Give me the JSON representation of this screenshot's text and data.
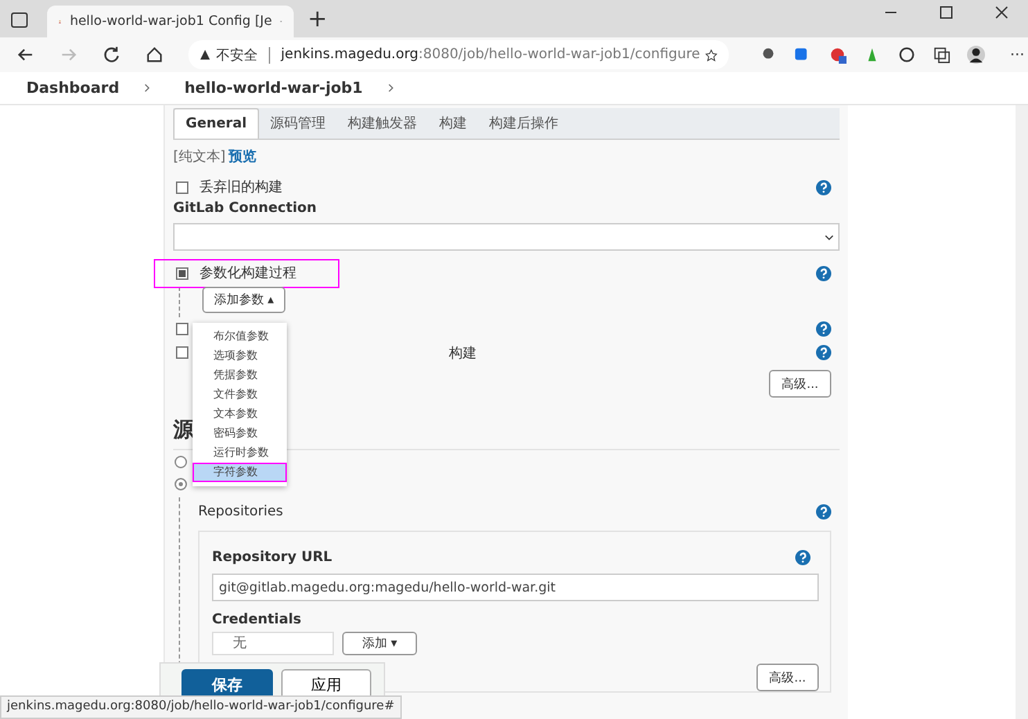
{
  "browser": {
    "tab_title": "hello-world-war-job1 Config [Je",
    "new_tab": "+",
    "security": "不安全",
    "url_host": "jenkins.magedu.org",
    "url_rest": ":8080/job/hello-world-war-job1/configure",
    "more": "···"
  },
  "breadcrumbs": [
    {
      "label": "Dashboard"
    },
    {
      "label": "hello-world-war-job1"
    }
  ],
  "tabs": [
    {
      "label": "General",
      "selected": true
    },
    {
      "label": "源码管理",
      "selected": false
    },
    {
      "label": "构建触发器",
      "selected": false
    },
    {
      "label": "构建",
      "selected": false
    },
    {
      "label": "构建后操作",
      "selected": false
    }
  ],
  "description_links": {
    "plain": "[纯文本]",
    "preview": "预览"
  },
  "options_top": [
    {
      "label": "丢弃旧的构建",
      "checked": false
    }
  ],
  "gitlab_connection": {
    "label": "GitLab Connection"
  },
  "param_option": {
    "label": "参数化构建过程",
    "checked": true,
    "highlighted": true
  },
  "add_param_button": "添加参数 ▴",
  "param_menu": [
    {
      "label": "布尔值参数",
      "selected": false,
      "highlighted": false
    },
    {
      "label": "选项参数",
      "selected": false,
      "highlighted": false
    },
    {
      "label": "凭据参数",
      "selected": false,
      "highlighted": false
    },
    {
      "label": "文件参数",
      "selected": false,
      "highlighted": false
    },
    {
      "label": "文本参数",
      "selected": false,
      "highlighted": false
    },
    {
      "label": "密码参数",
      "selected": false,
      "highlighted": false
    },
    {
      "label": "运行时参数",
      "selected": false,
      "highlighted": false
    },
    {
      "label": "字符参数",
      "selected": true,
      "highlighted": true
    }
  ],
  "options_bottom": [
    {
      "checked": false
    },
    {
      "label": "构建",
      "checked": false
    }
  ],
  "advanced_button": "高级...",
  "scm": {
    "heading": "源",
    "radios": [
      {
        "selected": false
      },
      {
        "selected": true
      }
    ],
    "repositories": "Repositories",
    "repo_url_label": "Repository URL",
    "repo_url": "git@gitlab.magedu.org:magedu/hello-world-war.git",
    "credentials_label": "Credentials",
    "credentials_value": "无",
    "add_button": "添加 ▾",
    "advanced_button": "高级..."
  },
  "save_bar": {
    "save": "保存",
    "apply": "应用"
  },
  "status_url": "jenkins.magedu.org:8080/job/hello-world-war-job1/configure#"
}
